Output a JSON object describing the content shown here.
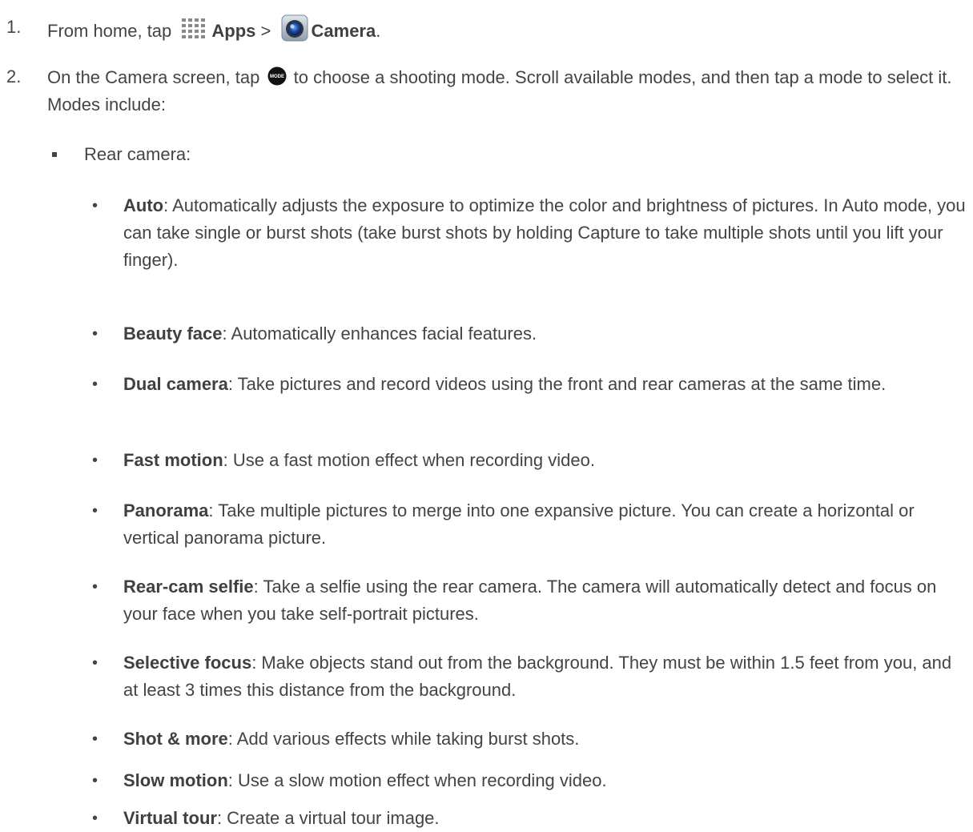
{
  "steps": [
    {
      "number": "1.",
      "prefix": "From home, tap",
      "apps_label": "Apps",
      "separator": ">",
      "camera_label": "Camera",
      "suffix": "."
    },
    {
      "number": "2.",
      "text_before_icon": "On the Camera screen, tap",
      "text_after_icon": "to choose a shooting mode. Scroll available modes, and then tap a mode to select it. Modes include:"
    }
  ],
  "subheading": "Rear camera:",
  "modes": [
    {
      "name": "Auto",
      "desc": ": Automatically adjusts the exposure to optimize the color and brightness of pictures. In Auto mode, you can take single or burst shots (take burst shots by holding Capture to take multiple shots until you lift your finger)."
    },
    {
      "name": "Beauty face",
      "desc": ": Automatically enhances facial features."
    },
    {
      "name": "Dual camera",
      "desc": ": Take pictures and record videos using the front and rear cameras at the same time."
    },
    {
      "name": "Fast motion",
      "desc": ": Use a fast motion effect when recording video."
    },
    {
      "name": "Panorama",
      "desc": ": Take multiple pictures to merge into one expansive picture. You can create a horizontal or vertical panorama picture."
    },
    {
      "name": "Rear-cam selfie",
      "desc": ": Take a selfie using the rear camera. The camera will automatically detect and focus on your face when you take self-portrait pictures."
    },
    {
      "name": "Selective focus",
      "desc": ": Make objects stand out from the background. They must be within 1.5 feet from you, and at least 3 times this distance from the background."
    },
    {
      "name": "Shot & more",
      "desc": ": Add various effects while taking burst shots."
    },
    {
      "name": "Slow motion",
      "desc": ": Use a slow motion effect when recording video."
    },
    {
      "name": "Virtual tour",
      "desc": ": Create a virtual tour image."
    }
  ],
  "bullet_glyph": "•",
  "icons": {
    "apps": "apps-grid-icon",
    "camera": "camera-app-icon",
    "mode": "mode-button-icon",
    "mode_text": "MODE"
  }
}
